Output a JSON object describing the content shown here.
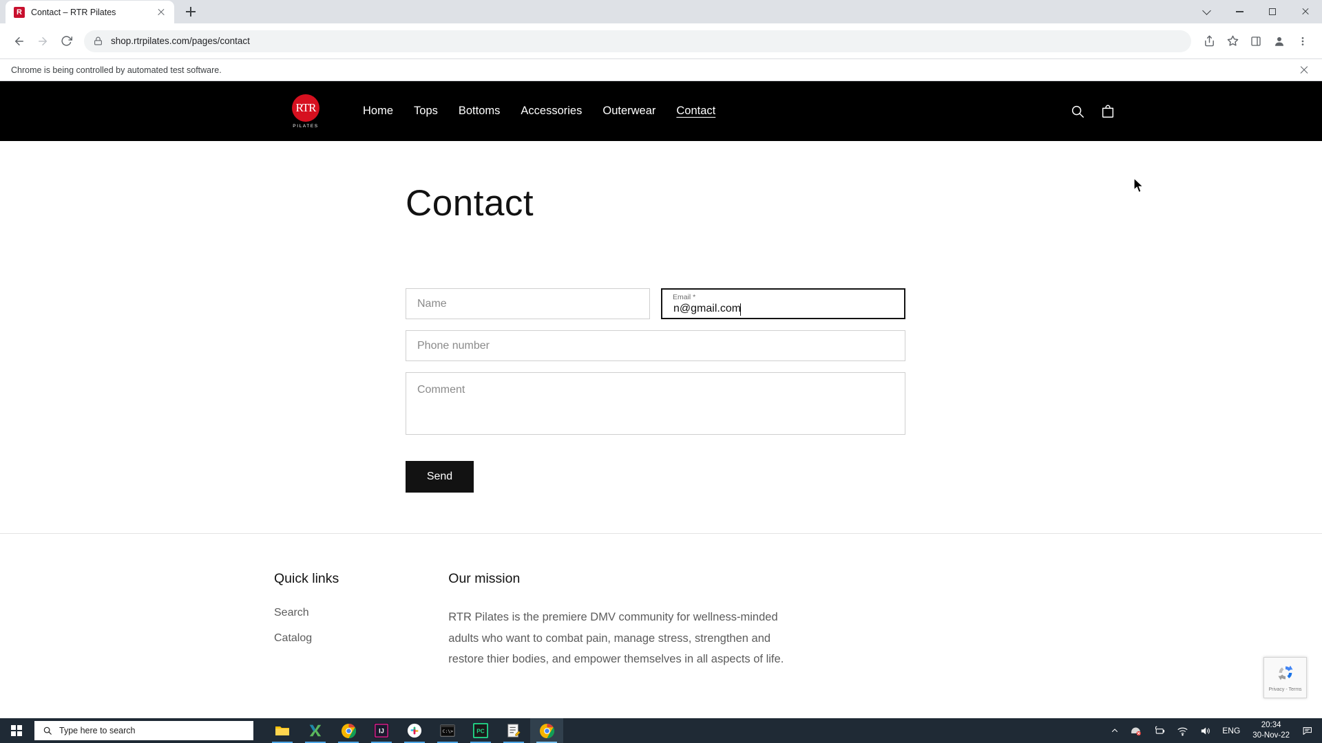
{
  "browser": {
    "tab": {
      "title": "Contact – RTR Pilates",
      "favicon_icon": "rtr-favicon"
    },
    "new_tab_icon": "plus-icon",
    "window_controls": {
      "minimize_icon": "minimize-icon",
      "maximize_icon": "maximize-icon",
      "close_icon": "close-icon",
      "tab_search_icon": "chevron-down-icon"
    },
    "toolbar": {
      "back_icon": "back-arrow-icon",
      "forward_icon": "forward-arrow-icon",
      "reload_icon": "reload-icon",
      "lock_icon": "lock-icon",
      "url": "shop.rtrpilates.com/pages/contact",
      "share_icon": "share-icon",
      "bookmark_icon": "star-icon",
      "sidepanel_icon": "side-panel-icon",
      "profile_icon": "profile-avatar-icon",
      "menu_icon": "three-dots-menu-icon"
    },
    "infobar": {
      "message": "Chrome is being controlled by automated test software.",
      "close_icon": "close-icon"
    }
  },
  "site": {
    "logo": {
      "mark": "RTR",
      "sub": "PILATES"
    },
    "nav": [
      {
        "label": "Home",
        "active": false
      },
      {
        "label": "Tops",
        "active": false
      },
      {
        "label": "Bottoms",
        "active": false
      },
      {
        "label": "Accessories",
        "active": false
      },
      {
        "label": "Outerwear",
        "active": false
      },
      {
        "label": "Contact",
        "active": true
      }
    ],
    "actions": {
      "search_icon": "search-icon",
      "cart_icon": "shopping-cart-icon"
    }
  },
  "main": {
    "title": "Contact",
    "form": {
      "name": {
        "placeholder": "Name",
        "value": ""
      },
      "email": {
        "label": "Email *",
        "placeholder": "Email",
        "value": "n@gmail.com",
        "focused": true
      },
      "phone": {
        "placeholder": "Phone number",
        "value": ""
      },
      "comment": {
        "placeholder": "Comment",
        "value": ""
      },
      "submit_label": "Send"
    }
  },
  "footer": {
    "quick_links": {
      "heading": "Quick links",
      "items": [
        "Search",
        "Catalog"
      ]
    },
    "mission": {
      "heading": "Our mission",
      "body": "RTR Pilates is the premiere DMV community for wellness-minded adults who want to combat pain, manage stress, strengthen and restore thier bodies, and empower themselves in all aspects of life."
    }
  },
  "recaptcha": {
    "text": "Privacy - Terms",
    "icon": "recaptcha-icon"
  },
  "taskbar": {
    "start_icon": "windows-start-icon",
    "search": {
      "icon": "search-icon",
      "placeholder": "Type here to search"
    },
    "apps": [
      {
        "name": "file-explorer",
        "running": true
      },
      {
        "name": "x-app",
        "running": true
      },
      {
        "name": "google-chrome",
        "running": true
      },
      {
        "name": "intellij-idea",
        "running": true
      },
      {
        "name": "slack",
        "running": true
      },
      {
        "name": "command-prompt",
        "running": true
      },
      {
        "name": "pycharm",
        "running": true
      },
      {
        "name": "text-editor",
        "running": true
      },
      {
        "name": "google-chrome-active",
        "running": true,
        "active": true
      }
    ],
    "tray": {
      "expand_icon": "chevron-up-icon",
      "device_muted_icon": "device-muted-icon",
      "battery_icon": "battery-charging-icon",
      "wifi_icon": "wifi-icon",
      "volume_icon": "volume-icon",
      "language": "ENG",
      "time": "20:34",
      "date": "30-Nov-22",
      "notifications_icon": "notifications-icon"
    }
  },
  "colors": {
    "brand_red": "#d6101f",
    "header_black": "#000000",
    "chrome_tabstrip": "#dee1e6",
    "taskbar": "#1f2a35"
  }
}
